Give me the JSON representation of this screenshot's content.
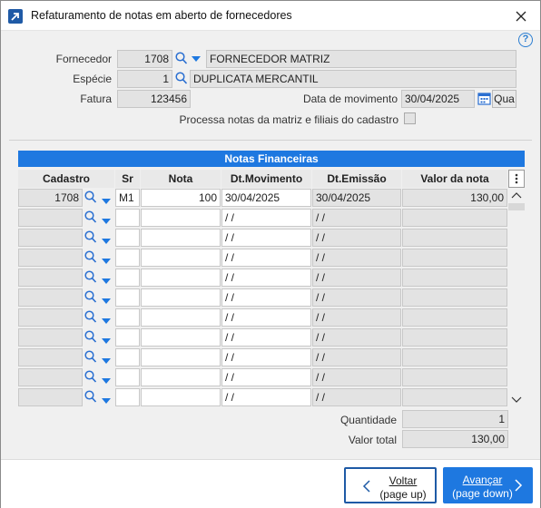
{
  "window": {
    "title": "Refaturamento de notas em aberto de fornecedores"
  },
  "form": {
    "fornecedor_label": "Fornecedor",
    "fornecedor_code": "1708",
    "fornecedor_name": "FORNECEDOR MATRIZ",
    "especie_label": "Espécie",
    "especie_code": "1",
    "especie_name": "DUPLICATA MERCANTIL",
    "fatura_label": "Fatura",
    "fatura_value": "123456",
    "data_mov_label": "Data de movimento",
    "data_mov_value": "30/04/2025",
    "qua_label": "Qua",
    "processa_label": "Processa notas da matriz e filiais do cadastro"
  },
  "grid": {
    "title": "Notas Financeiras",
    "headers": [
      "Cadastro",
      "Sr",
      "Nota",
      "Dt.Movimento",
      "Dt.Emissão",
      "Valor da nota"
    ],
    "rows": [
      {
        "cadastro": "1708",
        "sr": "M1",
        "nota": "100",
        "dt_mov": "30/04/2025",
        "dt_emi": "30/04/2025",
        "valor": "130,00"
      },
      {
        "cadastro": "",
        "sr": "",
        "nota": "",
        "dt_mov": " /  /",
        "dt_emi": " /  /",
        "valor": ""
      },
      {
        "cadastro": "",
        "sr": "",
        "nota": "",
        "dt_mov": " /  /",
        "dt_emi": " /  /",
        "valor": ""
      },
      {
        "cadastro": "",
        "sr": "",
        "nota": "",
        "dt_mov": " /  /",
        "dt_emi": " /  /",
        "valor": ""
      },
      {
        "cadastro": "",
        "sr": "",
        "nota": "",
        "dt_mov": " /  /",
        "dt_emi": " /  /",
        "valor": ""
      },
      {
        "cadastro": "",
        "sr": "",
        "nota": "",
        "dt_mov": " /  /",
        "dt_emi": " /  /",
        "valor": ""
      },
      {
        "cadastro": "",
        "sr": "",
        "nota": "",
        "dt_mov": " /  /",
        "dt_emi": " /  /",
        "valor": ""
      },
      {
        "cadastro": "",
        "sr": "",
        "nota": "",
        "dt_mov": " /  /",
        "dt_emi": " /  /",
        "valor": ""
      },
      {
        "cadastro": "",
        "sr": "",
        "nota": "",
        "dt_mov": " /  /",
        "dt_emi": " /  /",
        "valor": ""
      },
      {
        "cadastro": "",
        "sr": "",
        "nota": "",
        "dt_mov": " /  /",
        "dt_emi": " /  /",
        "valor": ""
      },
      {
        "cadastro": "",
        "sr": "",
        "nota": "",
        "dt_mov": " /  /",
        "dt_emi": " /  /",
        "valor": ""
      }
    ]
  },
  "totals": {
    "quantidade_label": "Quantidade",
    "quantidade_value": "1",
    "valor_total_label": "Valor total",
    "valor_total_value": "130,00"
  },
  "buttons": {
    "back_line1": "Voltar",
    "back_line2": "(page up)",
    "next_line1": "Avançar",
    "next_line2": "(page down)"
  },
  "colors": {
    "accent": "#1e78e0",
    "dark_accent": "#1e5aa6"
  },
  "icons": [
    "app-icon",
    "close-icon",
    "help-icon",
    "search-icon",
    "dropdown-arrow-icon",
    "calendar-icon",
    "kebab-menu-icon",
    "scroll-up-icon",
    "scroll-down-icon",
    "chevron-left-icon",
    "chevron-right-icon"
  ]
}
